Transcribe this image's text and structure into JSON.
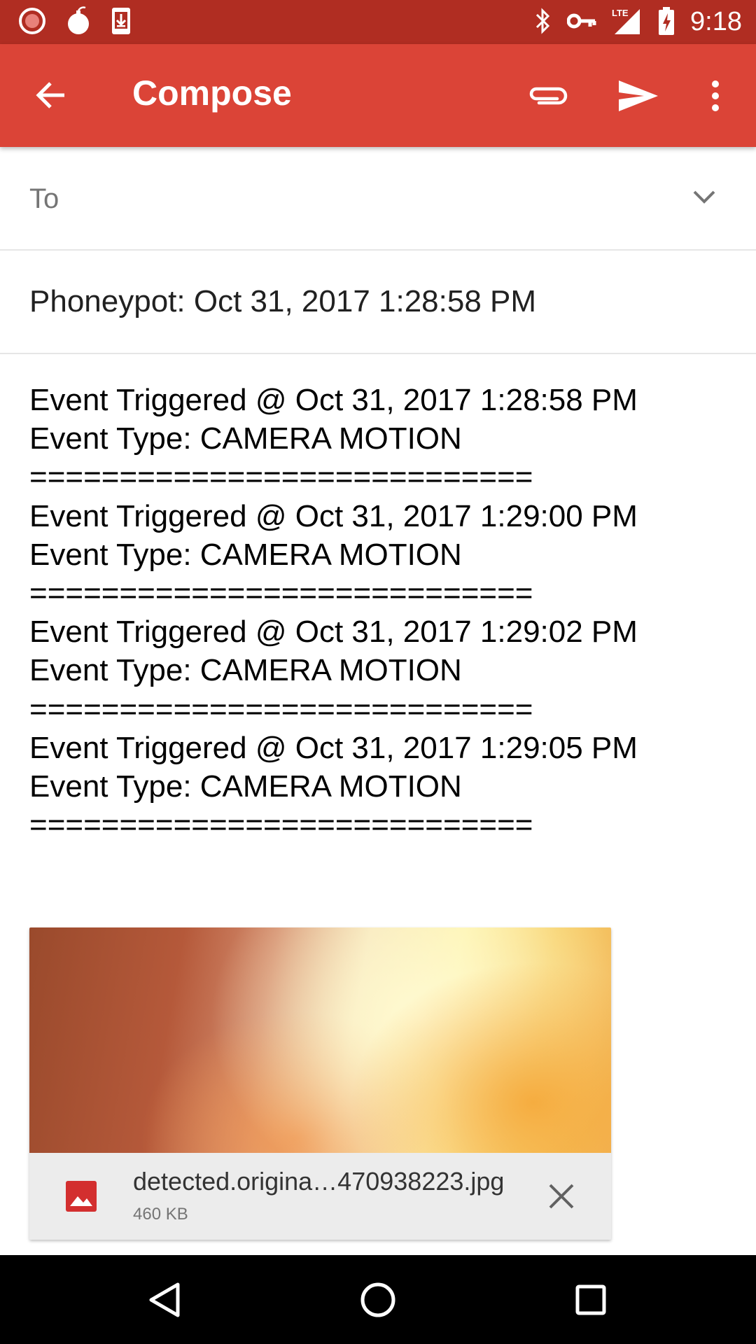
{
  "status_bar": {
    "time": "9:18",
    "network": "LTE",
    "icons_left": [
      "circle-record-icon",
      "bomb-icon",
      "download-phone-icon"
    ],
    "icons_right": [
      "bluetooth-icon",
      "vpn-key-icon",
      "signal-lte-icon",
      "battery-charging-icon"
    ]
  },
  "app_bar": {
    "title": "Compose",
    "actions": [
      "attach-icon",
      "send-icon",
      "more-vert-icon"
    ]
  },
  "compose": {
    "to_label": "To",
    "subject": "Phoneypot: Oct 31, 2017 1:28:58 PM",
    "body": "Event Triggered @ Oct 31, 2017 1:28:58 PM\nEvent Type: CAMERA MOTION\n============================\nEvent Triggered @ Oct 31, 2017 1:29:00 PM\nEvent Type: CAMERA MOTION\n============================\nEvent Triggered @ Oct 31, 2017 1:29:02 PM\nEvent Type: CAMERA MOTION\n============================\nEvent Triggered @ Oct 31, 2017 1:29:05 PM\nEvent Type: CAMERA MOTION\n============================"
  },
  "attachment": {
    "file_name": "detected.origina…470938223.jpg",
    "file_size": "460 KB"
  },
  "colors": {
    "status_bar": "#b02d22",
    "app_bar": "#db4437",
    "image_icon": "#d32f2f"
  }
}
